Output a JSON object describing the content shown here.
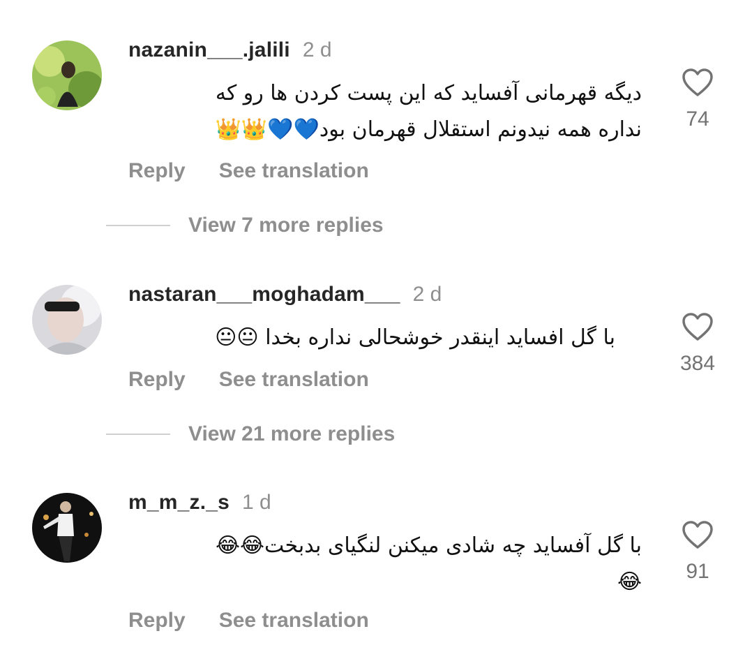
{
  "comments": [
    {
      "username": "nazanin___.jalili",
      "time": "2 d",
      "lines": [
        "دیگه قهرمانی آفساید که این پست کردن ها رو که",
        "نداره همه نیدونم استقلال قهرمان بود💙💙👑👑"
      ],
      "likes": "74",
      "reply": "Reply",
      "translate": "See translation",
      "view_more": "View 7 more replies"
    },
    {
      "username": "nastaran___moghadam___",
      "time": "2 d",
      "lines": [
        "با گل افساید  اینقدر  خوشحالی  نداره بخدا 😐😐"
      ],
      "likes": "384",
      "reply": "Reply",
      "translate": "See translation",
      "view_more": "View 21 more replies"
    },
    {
      "username": "m_m_z._s",
      "time": "1 d",
      "lines": [
        "با گل آفساید چه شادی میکنن لنگیای بدبخت😂😂",
        "😂"
      ],
      "likes": "91",
      "reply": "Reply",
      "translate": "See translation"
    }
  ],
  "icons": {
    "like": "heart-outline-icon"
  },
  "colors": {
    "username": "#262626",
    "muted": "#8e8e8e",
    "divider": "#d0d0d0"
  }
}
